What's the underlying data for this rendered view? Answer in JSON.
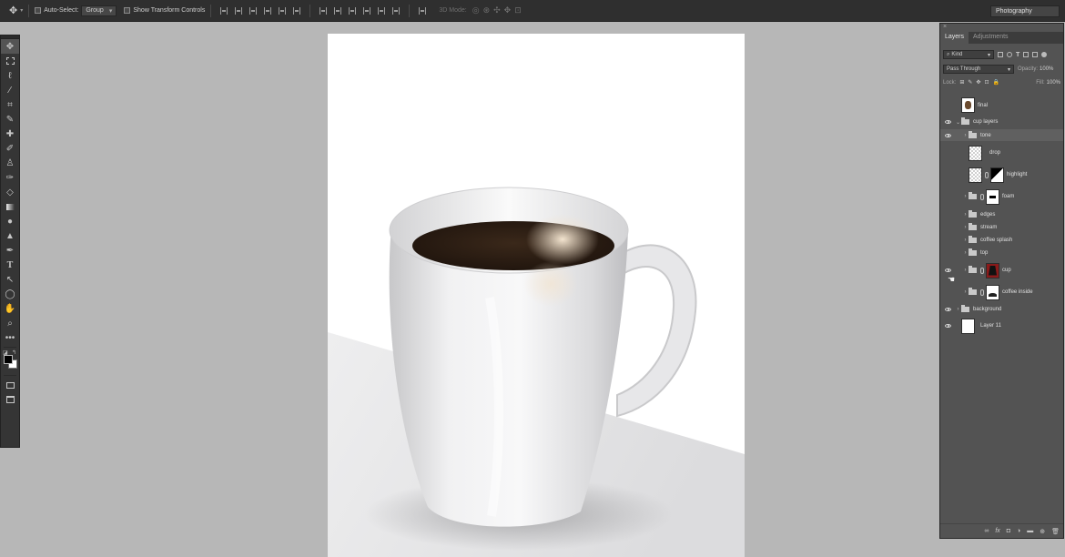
{
  "options_bar": {
    "auto_select_label": "Auto-Select:",
    "auto_select_value": "Group",
    "transform_label": "Show Transform Controls",
    "mode_3d_label": "3D Mode:",
    "workspace": "Photography"
  },
  "tools": [
    "move-tool",
    "marquee-tool",
    "lasso-tool",
    "magic-wand-tool",
    "crop-tool",
    "eyedropper-tool",
    "healing-tool",
    "brush-tool",
    "clone-stamp-tool",
    "history-brush-tool",
    "eraser-tool",
    "gradient-tool",
    "blur-tool",
    "dodge-tool",
    "pen-tool",
    "type-tool",
    "path-selection-tool",
    "shape-tool",
    "hand-tool",
    "zoom-tool",
    "more-tools"
  ],
  "colors": {
    "foreground": "#000000",
    "background": "#ffffff",
    "coffee": "#2f1f14"
  },
  "layers_panel": {
    "tabs": [
      "Layers",
      "Adjustments"
    ],
    "filter": "Kind",
    "blend_mode": "Pass Through",
    "opacity_label": "Opacity:",
    "opacity": "100%",
    "lock_label": "Lock:",
    "fill_label": "Fill:",
    "fill": "100%",
    "layers": [
      {
        "name": "final"
      },
      {
        "name": "cup layers"
      },
      {
        "name": "tone"
      },
      {
        "name": "drop"
      },
      {
        "name": "highlight"
      },
      {
        "name": "foam"
      },
      {
        "name": "edges"
      },
      {
        "name": "stream"
      },
      {
        "name": "coffee splash"
      },
      {
        "name": "top"
      },
      {
        "name": "cup"
      },
      {
        "name": "coffee inside"
      },
      {
        "name": "background"
      },
      {
        "name": "Layer 11"
      }
    ]
  }
}
